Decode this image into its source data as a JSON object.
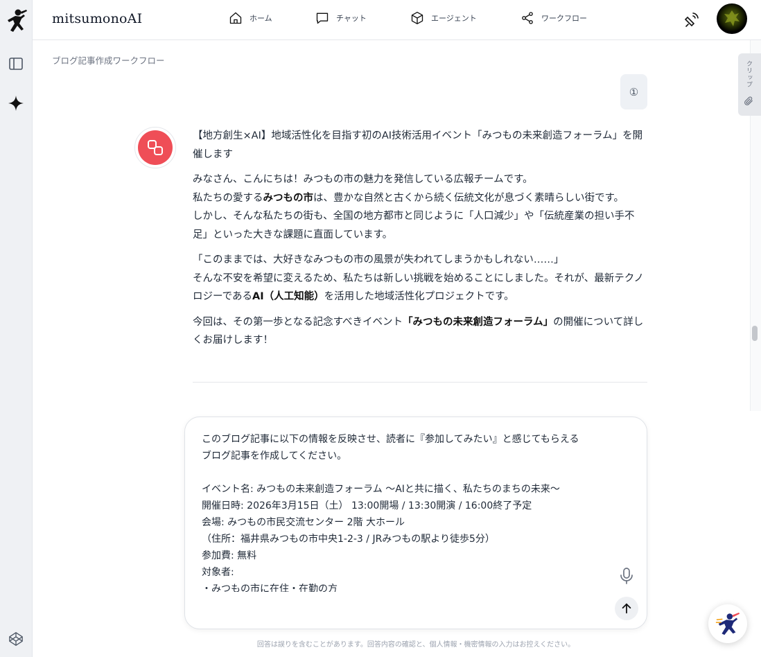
{
  "app": {
    "brand": "mitsumonoAI",
    "colors": {
      "accent": "#ef4e57",
      "rail_bg": "#eff1f4"
    }
  },
  "nav": {
    "items": [
      {
        "label": "ホーム",
        "icon": "home-icon"
      },
      {
        "label": "チャット",
        "icon": "chat-icon"
      },
      {
        "label": "エージェント",
        "icon": "cube-icon"
      },
      {
        "label": "ワークフロー",
        "icon": "share-icon"
      }
    ]
  },
  "rail": {
    "icons": [
      "ninja-logo-icon",
      "sidebar-toggle-icon",
      "sparkle-icon",
      "codepen-icon"
    ]
  },
  "breadcrumb": "ブログ記事作成ワークフロー",
  "mini_badge": "①",
  "clip_tab": {
    "label": "クリップ",
    "icon": "paperclip-icon"
  },
  "article": {
    "p1": "【地方創生×AI】地域活性化を目指す初のAI技術活用イベント「みつもの未来創造フォーラム」を開催します",
    "p2_l1": "みなさん、こんにちは！みつもの市の魅力を発信している広報チームです。",
    "p2_l2a": "私たちの愛する",
    "p2_l2b": "みつもの市",
    "p2_l2c": "は、豊かな自然と古くから続く伝統文化が息づく素晴らしい街です。",
    "p2_l3": "しかし、そんな私たちの街も、全国の地方都市と同じように「人口減少」や「伝統産業の担い手不足」といった大きな課題に直面しています。",
    "p3_l1": "「このままでは、大好きなみつもの市の風景が失われてしまうかもしれない……」",
    "p3_l2a": "そんな不安を希望に変えるため、私たちは新しい挑戦を始めることにしました。それが、最新テクノロジーである",
    "p3_l2b": "AI（人工知能）",
    "p3_l2c": "を活用した地域活性化プロジェクトです。",
    "p4a": "今回は、その第一歩となる記念すべきイベント",
    "p4b": "「みつもの未来創造フォーラム」",
    "p4c": "の開催について詳しくお届けします！"
  },
  "composer": {
    "text": "このブログ記事に以下の情報を反映させ、読者に『参加してみたい』と感じてもらえる\nブログ記事を作成してください。\n\nイベント名: みつもの未来創造フォーラム 〜AIと共に描く、私たちのまちの未来〜\n開催日時: 2026年3月15日（土） 13:00開場 / 13:30開演 / 16:00終了予定\n会場: みつもの市民交流センター 2階 大ホール\n（住所：福井県みつもの市中央1-2-3 / JRみつもの駅より徒歩5分）\n参加費: 無料\n対象者:\n・みつもの市に在住・在勤の方"
  },
  "disclaimer": "回答は誤りを含むことがあります。回答内容の確認と、個人情報・機密情報の入力はお控えください。"
}
